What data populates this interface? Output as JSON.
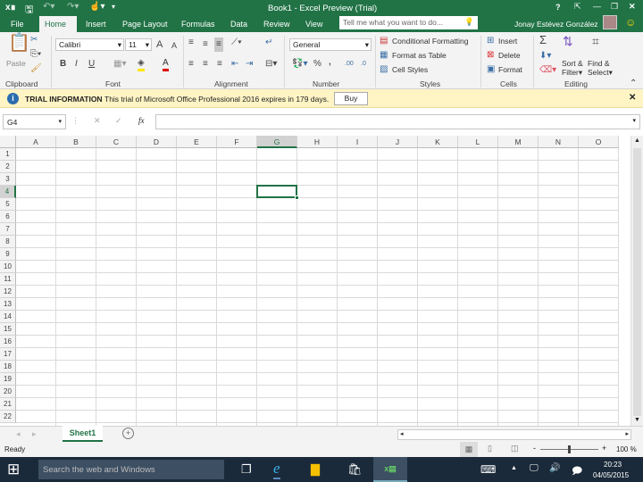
{
  "title": "Book1 - Excel Preview (Trial)",
  "quick_access": [
    "excel-logo-icon",
    "save-icon",
    "undo-icon",
    "redo-icon",
    "touch-mode-icon",
    "customize-icon"
  ],
  "window_controls": {
    "help": "?",
    "restore_ribbon": "⇱",
    "minimize": "—",
    "maximize": "❐",
    "close": "✕"
  },
  "tabs": [
    "File",
    "Home",
    "Insert",
    "Page Layout",
    "Formulas",
    "Data",
    "Review",
    "View"
  ],
  "active_tab": "Home",
  "tell_me_placeholder": "Tell me what you want to do...",
  "user_name": "Jonay Estévez González",
  "ribbon": {
    "clipboard": {
      "label": "Clipboard",
      "paste": "Paste"
    },
    "font": {
      "label": "Font",
      "name": "Calibri",
      "size": "11",
      "bold": "B",
      "italic": "I",
      "underline": "U",
      "grow": "A",
      "shrink": "A",
      "color": "A"
    },
    "alignment": {
      "label": "Alignment"
    },
    "number": {
      "label": "Number",
      "format": "General",
      "percent": "%",
      "comma": "‚",
      "inc": ".00",
      "dec": ".0"
    },
    "styles": {
      "label": "Styles",
      "conditional": "Conditional Formatting",
      "table": "Format as Table",
      "cell_styles": "Cell Styles"
    },
    "cells": {
      "label": "Cells",
      "insert": "Insert",
      "delete": "Delete",
      "format": "Format"
    },
    "editing": {
      "label": "Editing",
      "sum": "Σ",
      "sort1": "Sort &",
      "sort2": "Filter",
      "find1": "Find &",
      "find2": "Select"
    }
  },
  "trial": {
    "title": "TRIAL INFORMATION",
    "message": "This trial of Microsoft Office Professional 2016 expires in 179 days.",
    "button": "Buy"
  },
  "formula_bar": {
    "name_box": "G4",
    "fx": "fx",
    "value": ""
  },
  "columns": [
    "A",
    "B",
    "C",
    "D",
    "E",
    "F",
    "G",
    "H",
    "I",
    "J",
    "K",
    "L",
    "M",
    "N",
    "O"
  ],
  "rows": [
    "1",
    "2",
    "3",
    "4",
    "5",
    "6",
    "7",
    "8",
    "9",
    "10",
    "11",
    "12",
    "13",
    "14",
    "15",
    "16",
    "17",
    "18",
    "19",
    "20",
    "21",
    "22"
  ],
  "selected_cell": "G4",
  "sheets": [
    "Sheet1"
  ],
  "status": {
    "ready": "Ready",
    "zoom": "100 %"
  },
  "taskbar": {
    "search": "Search the web and Windows",
    "time": "20:23",
    "date": "04/05/2015"
  },
  "colors": {
    "accent": "#217346",
    "trial": "#fff4c4"
  }
}
